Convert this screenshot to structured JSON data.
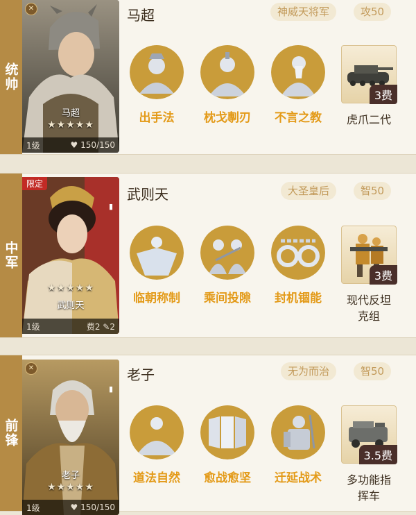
{
  "rows": [
    {
      "role": "统帅",
      "name": "马超",
      "title_tag": "神威天将军",
      "stat_tag": "攻50",
      "portrait": {
        "name": "马超",
        "stars": "★★★★★",
        "level": "1级",
        "hp": "150/150",
        "hp_icon": "heart-icon",
        "badge_icon": "crossed-swords-icon"
      },
      "skills": [
        {
          "label": "出手法",
          "icon": "warrior-portrait-icon"
        },
        {
          "label": "枕戈剸刃",
          "icon": "scholar-portrait-icon"
        },
        {
          "label": "不言之教",
          "icon": "sage-portrait-icon"
        }
      ],
      "unit": {
        "label": "虎爪二代",
        "cost": "3费",
        "icon": "tank-icon"
      }
    },
    {
      "role": "中军",
      "name": "武则天",
      "title_tag": "大圣皇后",
      "stat_tag": "智50",
      "portrait": {
        "name": "武则天",
        "stars": "★★★★★",
        "level": "1级",
        "cost": "费2",
        "cost_extra": "2",
        "limited": "限定",
        "cost_icon": "feather-icon"
      },
      "skills": [
        {
          "label": "临朝称制",
          "icon": "robe-figure-icon"
        },
        {
          "label": "乘间投隙",
          "icon": "duel-icon"
        },
        {
          "label": "封机锢能",
          "icon": "chain-gear-icon"
        }
      ],
      "unit": {
        "label": "现代反坦克组",
        "label_line1": "现代反坦",
        "label_line2": "克组",
        "cost": "3费",
        "icon": "antitank-crew-icon"
      }
    },
    {
      "role": "前锋",
      "name": "老子",
      "title_tag": "无为而治",
      "stat_tag": "智50",
      "portrait": {
        "name": "老子",
        "stars": "★★★★★",
        "level": "1级",
        "hp": "150/150",
        "hp_icon": "heart-icon",
        "badge_icon": "crossed-swords-icon"
      },
      "skills": [
        {
          "label": "道法自然",
          "icon": "meditating-sage-icon"
        },
        {
          "label": "愈战愈坚",
          "icon": "shield-wall-icon"
        },
        {
          "label": "迁延战术",
          "icon": "armored-soldier-icon"
        }
      ],
      "unit": {
        "label": "多功能指挥车",
        "label_line1": "多功能指",
        "label_line2": "挥车",
        "cost": "3.5费",
        "icon": "command-vehicle-icon"
      }
    }
  ],
  "colors": {
    "role_strip": "#b58b45",
    "skill_label": "#e39a18",
    "tag_bg": "#f2e9d3",
    "tag_text": "#c29a5a",
    "background": "#f8f5ed"
  }
}
